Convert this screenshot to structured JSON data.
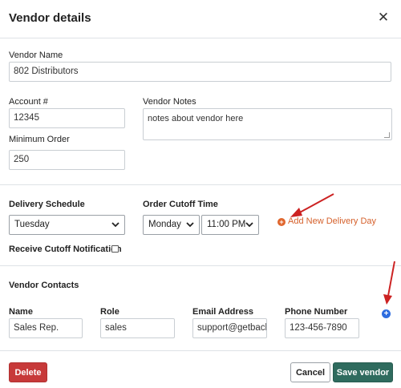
{
  "modal": {
    "title": "Vendor details",
    "close_icon": "close-icon"
  },
  "vendor": {
    "name_label": "Vendor Name",
    "name_value": "802 Distributors",
    "account_label": "Account #",
    "account_value": "12345",
    "notes_label": "Vendor Notes",
    "notes_value": "notes about vendor here",
    "min_order_label": "Minimum Order",
    "min_order_value": "250"
  },
  "delivery": {
    "schedule_label": "Delivery Schedule",
    "schedule_value": "Tuesday",
    "cutoff_label": "Order Cutoff Time",
    "cutoff_day_value": "Monday",
    "cutoff_time_value": "11:00 PM",
    "add_day_label": "Add New Delivery Day",
    "notification_label": "Receive Cutoff Notification",
    "notification_checked": false
  },
  "contacts": {
    "section_label": "Vendor Contacts",
    "headers": [
      "Name",
      "Role",
      "Email Address",
      "Phone Number"
    ],
    "rows": [
      {
        "name": "Sales Rep.",
        "role": "sales",
        "email": "support@getback",
        "phone": "123-456-7890"
      }
    ]
  },
  "footer": {
    "delete_label": "Delete",
    "cancel_label": "Cancel",
    "save_label": "Save vendor"
  },
  "annotations": {
    "arrow_color": "#cc2222"
  },
  "colors": {
    "delete": "#c73a3a",
    "save": "#2f6b5e",
    "add_link": "#d5602b",
    "add_contact": "#2d6cdf"
  }
}
